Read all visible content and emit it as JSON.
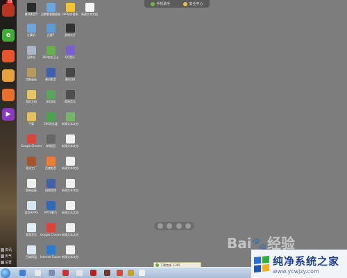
{
  "dock": {
    "badge": "58",
    "items": [
      {
        "name": "qq-game-icon",
        "color": "#b83520"
      },
      {
        "name": "browser-icon",
        "color": "#3fae37"
      },
      {
        "name": "app-center-icon",
        "color": "#e8552d"
      },
      {
        "name": "mail-icon",
        "color": "#e8a23b"
      },
      {
        "name": "game-controller-icon",
        "color": "#e86f2c"
      },
      {
        "name": "video-player-icon",
        "color": "#8b3ac0"
      }
    ],
    "bottom": [
      "资讯",
      "天气",
      "设置"
    ]
  },
  "topbar": {
    "items": [
      {
        "label": "手机助手",
        "color": "#6dbb3a"
      },
      {
        "label": "安全中心",
        "color": "#e7c43b"
      }
    ]
  },
  "desktop_icons": [
    {
      "label": "暴风影音5",
      "color": "#2b2b2b"
    },
    {
      "label": "迅雷看看播放器",
      "color": "#6aa7e0"
    },
    {
      "label": "360软件管家",
      "color": "#f1c232"
    },
    {
      "label": "新建文本文档",
      "color": "#f5f5f5"
    },
    {
      "label": "计算机",
      "color": "#6fa4d8"
    },
    {
      "label": "迅雷7",
      "color": "#5b9bd5"
    },
    {
      "label": "游戏大厅",
      "color": "#333333"
    },
    {
      "label": "回收站",
      "color": "#a9b7c6"
    },
    {
      "label": "360安全卫士",
      "color": "#62b14a"
    },
    {
      "label": "QQ音乐",
      "color": "#7a5fd1"
    },
    {
      "label": "控制面板",
      "color": "#b89a5c"
    },
    {
      "label": "暴风影音",
      "color": "#3d5fb4"
    },
    {
      "label": "腾讯QQ",
      "color": "#484848"
    },
    {
      "label": "我的文档",
      "color": "#e5c660"
    },
    {
      "label": "QQ游戏",
      "color": "#58a55c"
    },
    {
      "label": "酷狗音乐",
      "color": "#4f4f4f"
    },
    {
      "label": "下载",
      "color": "#e2c05a"
    },
    {
      "label": "360浏览器",
      "color": "#4ba34a"
    },
    {
      "label": "新建文本文档",
      "color": "#74b566"
    },
    {
      "label": "Google Chrome",
      "color": "#db4437"
    },
    {
      "label": "QQ影音",
      "color": "#666666"
    },
    {
      "label": "新建文本文档",
      "color": "#f0f0f0"
    },
    {
      "label": "格式工厂",
      "color": "#a8542b"
    },
    {
      "label": "百度影音",
      "color": "#ee7d31"
    },
    {
      "label": "新建文本文档",
      "color": "#f0f0f0"
    },
    {
      "label": "宽带连接",
      "color": "#eeeeee"
    },
    {
      "label": "网络游戏",
      "color": "#3f62a8"
    },
    {
      "label": "新建文本文档",
      "color": "#f0f0f0"
    },
    {
      "label": "爱奇艺PPS",
      "color": "#d5e6ee"
    },
    {
      "label": "PPTV聚力",
      "color": "#2d6bb8"
    },
    {
      "label": "新建文本文档",
      "color": "#f0f0f0"
    },
    {
      "label": "酷我音乐",
      "color": "#e3eef3"
    },
    {
      "label": "Google Chrome",
      "color": "#db4437"
    },
    {
      "label": "新建文本文档",
      "color": "#f0f0f0"
    },
    {
      "label": "百度网盘",
      "color": "#d9e9ef"
    },
    {
      "label": "Internet Explorer",
      "color": "#2a7cd3"
    },
    {
      "label": "新建文本文档",
      "color": "#f0f0f0"
    }
  ],
  "notification": {
    "text": "下载完成 1,305"
  },
  "watermark": {
    "text": "Bai",
    "text2": "经验"
  },
  "site": {
    "title": "纯净系统之家",
    "url": "www.ycwjzy.com"
  },
  "taskbar_items": [
    {
      "color": "#3b7fd8"
    },
    {
      "color": "#e8e8e8"
    },
    {
      "color": "#7b8eb0"
    },
    {
      "color": "#cc3333"
    },
    {
      "color": "#e3e3e3"
    },
    {
      "color": "#b3241e"
    },
    {
      "color": "#6b3a2c"
    },
    {
      "color": "#d44b3c"
    },
    {
      "color": "#c8a030"
    },
    {
      "color": "#f0f0f0"
    }
  ]
}
